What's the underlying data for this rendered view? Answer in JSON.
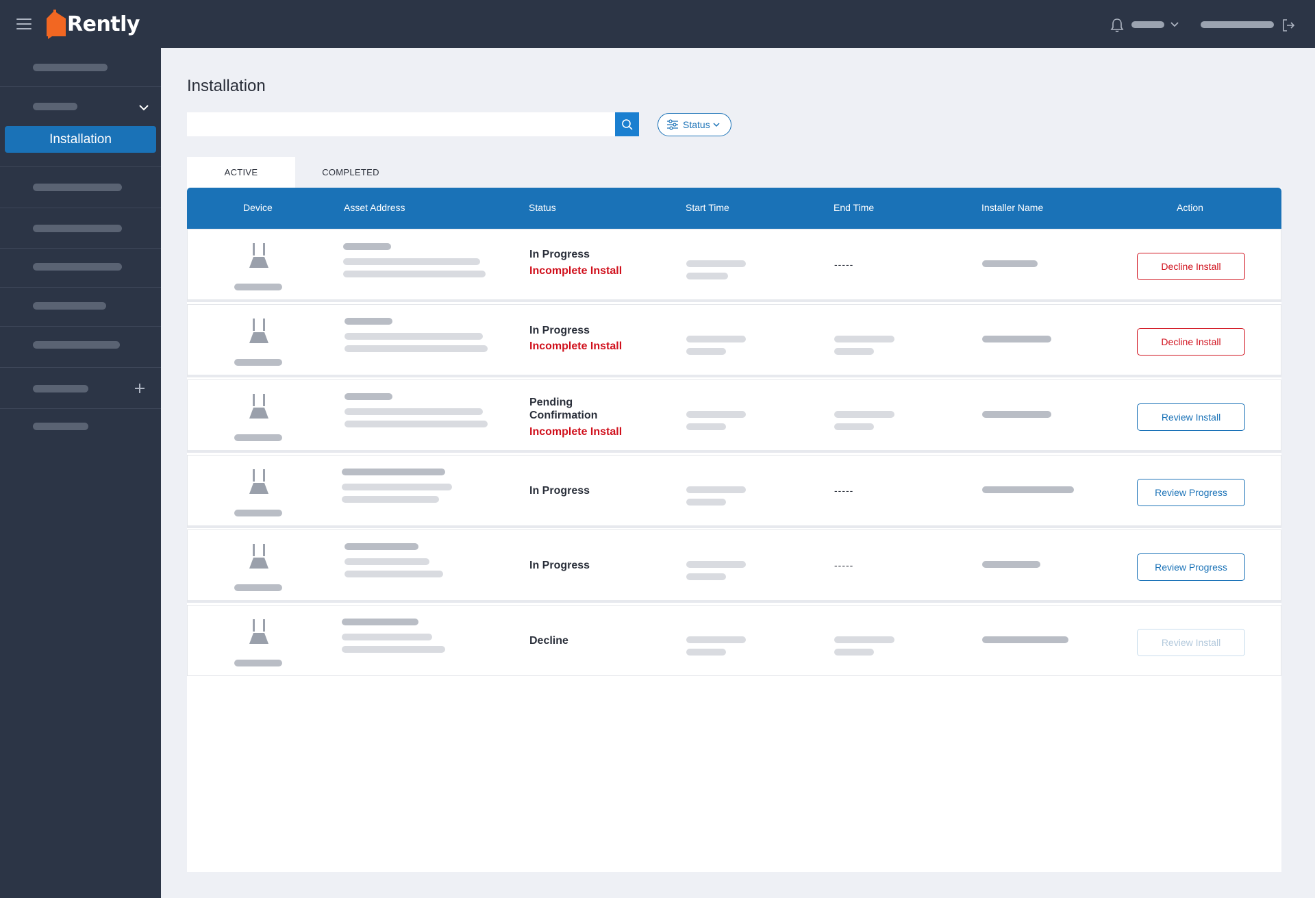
{
  "app": {
    "logo_text": "Rently"
  },
  "sidebar": {
    "active_item": "Installation"
  },
  "page": {
    "title": "Installation"
  },
  "search": {
    "placeholder": ""
  },
  "filter": {
    "label": "Status"
  },
  "tabs": [
    {
      "label": "ACTIVE"
    },
    {
      "label": "COMPLETED"
    }
  ],
  "table": {
    "columns": [
      "Device",
      "Asset Address",
      "Status",
      "Start Time",
      "End Time",
      "Installer Name",
      "Action"
    ],
    "rows": [
      {
        "status": "In Progress",
        "substatus": "Incomplete Install",
        "end_time": "-----",
        "action": "Decline Install",
        "action_style": "red"
      },
      {
        "status": "In Progress",
        "substatus": "Incomplete Install",
        "end_time": "",
        "action": "Decline Install",
        "action_style": "red"
      },
      {
        "status": "Pending Confirmation",
        "substatus": "Incomplete Install",
        "end_time": "",
        "action": "Review Install",
        "action_style": "blue"
      },
      {
        "status": "In Progress",
        "substatus": "",
        "end_time": "-----",
        "action": "Review Progress",
        "action_style": "blue"
      },
      {
        "status": "In Progress",
        "substatus": "",
        "end_time": "-----",
        "action": "Review Progress",
        "action_style": "blue"
      },
      {
        "status": "Decline",
        "substatus": "",
        "end_time": "",
        "action": "Review Install",
        "action_style": "disabled"
      }
    ]
  },
  "colors": {
    "brand_blue": "#1a72b7",
    "alert_red": "#d0101c",
    "nav_bg": "#2c3546",
    "logo_orange": "#f26722"
  },
  "icons": [
    "menu-icon",
    "bell-icon",
    "chevron-down-icon",
    "logout-icon",
    "search-icon",
    "filter-icon",
    "plus-icon",
    "device-icon"
  ]
}
